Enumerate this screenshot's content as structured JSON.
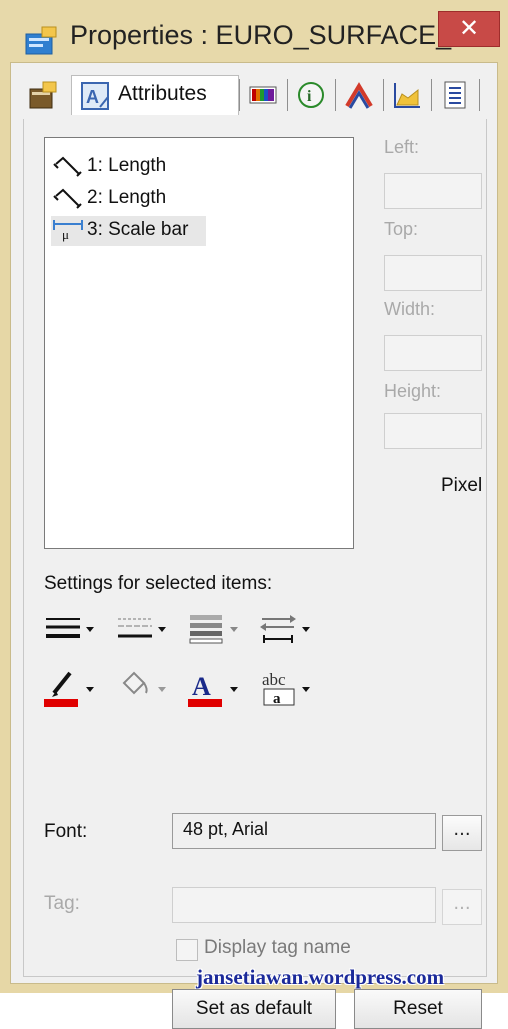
{
  "window": {
    "title": "Properties : EURO_SURFACE_...",
    "close_glyph": "✕"
  },
  "tabs": [
    {
      "name": "general-tab",
      "icon": "properties-icon",
      "label": ""
    },
    {
      "name": "attributes-tab",
      "icon": "attributes-icon",
      "label": "Attributes",
      "active": true
    },
    {
      "name": "palette-tab",
      "icon": "color-palette-icon",
      "label": ""
    },
    {
      "name": "info-tab",
      "icon": "info-icon",
      "label": ""
    },
    {
      "name": "layers-tab",
      "icon": "layers-icon",
      "label": ""
    },
    {
      "name": "chart-tab",
      "icon": "chart-icon",
      "label": ""
    },
    {
      "name": "list-tab",
      "icon": "list-icon",
      "label": ""
    }
  ],
  "items": [
    {
      "label": "1: Length",
      "icon": "length-line-icon",
      "selected": false
    },
    {
      "label": "2: Length",
      "icon": "length-line-icon",
      "selected": false
    },
    {
      "label": "3: Scale bar",
      "icon": "scale-bar-icon",
      "selected": true
    }
  ],
  "geometry": {
    "left_label": "Left:",
    "top_label": "Top:",
    "width_label": "Width:",
    "height_label": "Height:",
    "unit": "Pixel"
  },
  "settings": {
    "label": "Settings for selected items:",
    "tools": [
      "line-width-icon",
      "line-style-icon",
      "fill-pattern-icon",
      "arrow-style-icon",
      "line-color-icon",
      "fill-color-icon",
      "font-color-icon",
      "text-background-icon"
    ],
    "line_color": "#e00000",
    "font_color": "#e00000",
    "text_sample": "abc",
    "text_sample_boxed": "a"
  },
  "font": {
    "label": "Font:",
    "value": "48 pt, Arial",
    "browse_label": "..."
  },
  "tag": {
    "label": "Tag:",
    "value": "",
    "browse_label": "..."
  },
  "display_tag_name": {
    "label": "Display tag name",
    "checked": false
  },
  "watermark": "jansetiawan.wordpress.com",
  "buttons": {
    "set_default": "Set as default",
    "reset": "Reset"
  }
}
